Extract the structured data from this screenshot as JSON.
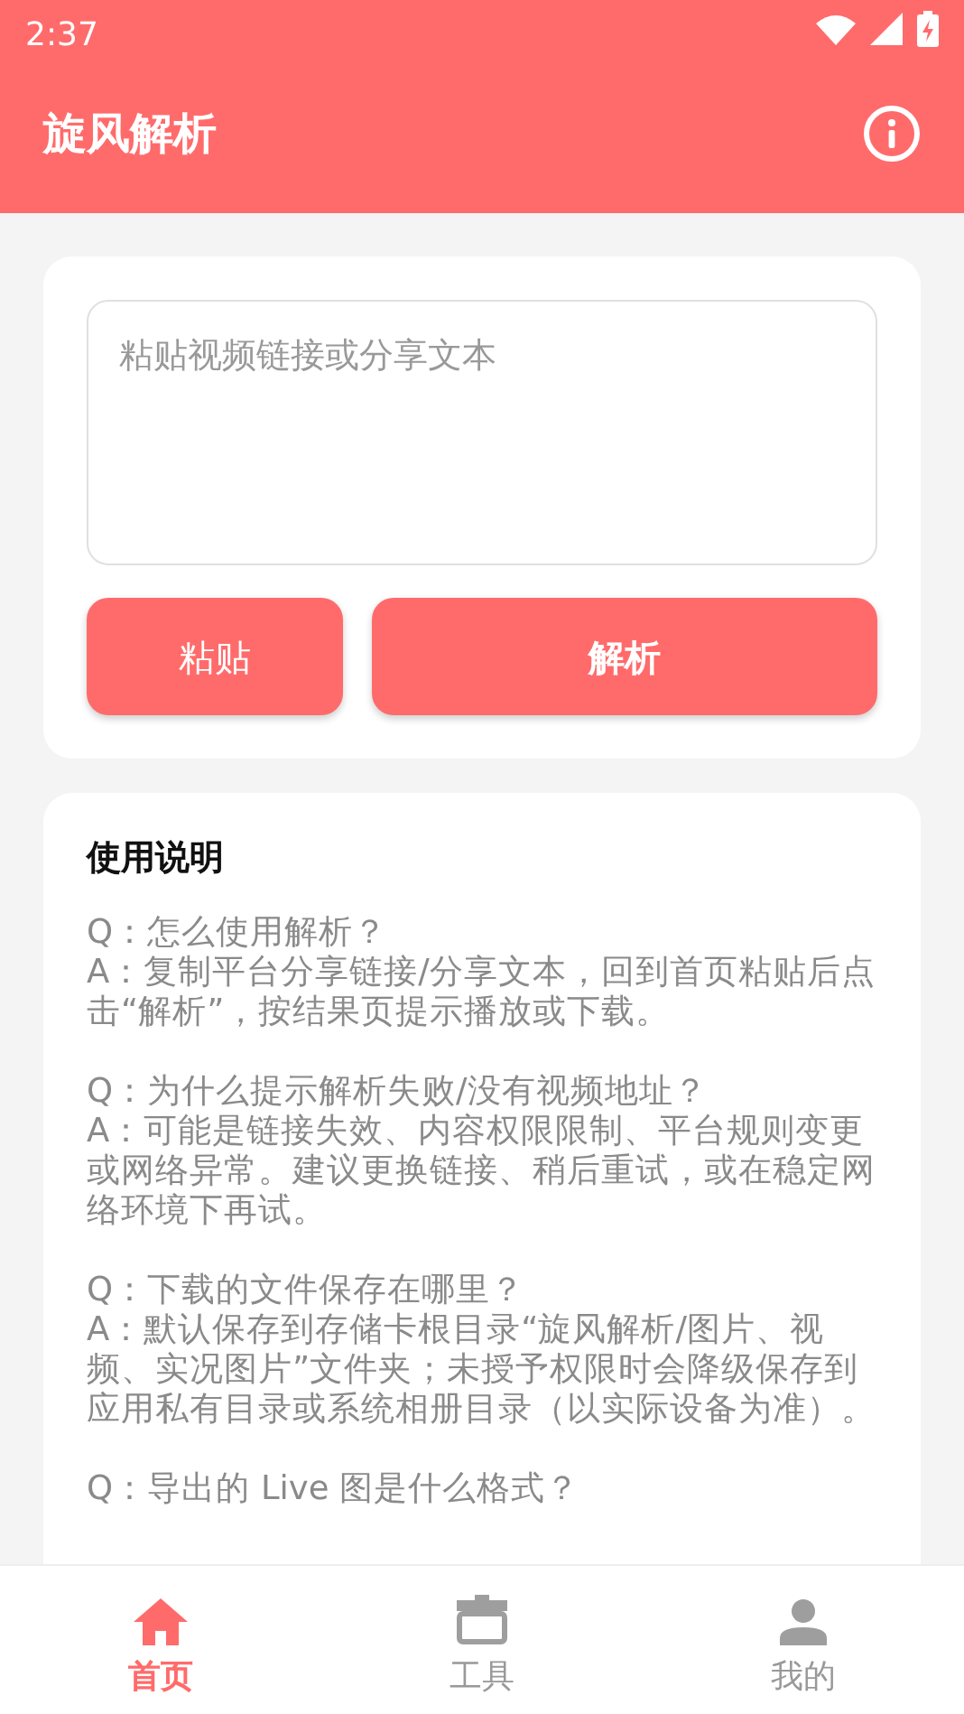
{
  "status_bar": {
    "time": "2:37"
  },
  "app_bar": {
    "title": "旋风解析"
  },
  "input": {
    "placeholder": "粘贴视频链接或分享文本"
  },
  "buttons": [
    {
      "label": "粘贴",
      "kind": "secondary"
    },
    {
      "label": "解析",
      "kind": "primary"
    }
  ],
  "help": {
    "title": "使用说明",
    "faq": [
      {
        "q": "Q：怎么使用解析？",
        "a": "A：复制平台分享链接/分享文本，回到首页粘贴后点击“解析”，按结果页提示播放或下载。"
      },
      {
        "q": "Q：为什么提示解析失败/没有视频地址？",
        "a": "A：可能是链接失效、内容权限限制、平台规则变更或网络异常。建议更换链接、稍后重试，或在稳定网络环境下再试。"
      },
      {
        "q": "Q：下载的文件保存在哪里？",
        "a": "A：默认保存到存储卡根目录“旋风解析/图片、视频、实况图片”文件夹；未授予权限时会降级保存到应用私有目录或系统相册目录（以实际设备为准）。"
      },
      {
        "q": "Q：导出的 Live 图是什么格式？"
      }
    ]
  },
  "bottom_nav": [
    {
      "label": "首页",
      "kind": "home",
      "selected": true
    },
    {
      "label": "工具",
      "kind": "tools",
      "selected": false
    },
    {
      "label": "我的",
      "kind": "profile",
      "selected": false
    }
  ]
}
